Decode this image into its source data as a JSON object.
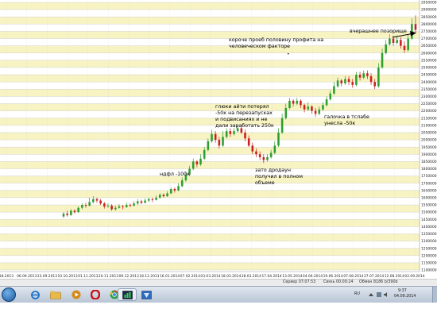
{
  "chart_data": {
    "type": "candlestick",
    "y_ticks": [
      "2950000",
      "2900000",
      "2850000",
      "2800000",
      "2750000",
      "2700000",
      "2650000",
      "2600000",
      "2550000",
      "2500000",
      "2450000",
      "2400000",
      "2350000",
      "2300000",
      "2250000",
      "2200000",
      "2150000",
      "2100000",
      "2050000",
      "2000000",
      "1950000",
      "1900000",
      "1850000",
      "1800000",
      "1750000",
      "1700000",
      "1650000",
      "1600000",
      "1550000",
      "1500000",
      "1450000",
      "1400000",
      "1350000",
      "1300000",
      "1250000",
      "1200000",
      "1150000",
      "1100000"
    ],
    "ylim": [
      1100000,
      2950000
    ],
    "x_ticks": [
      "18.2013",
      "06.09.2013",
      "23.09.2013",
      "10.10.2013",
      "01.11.2013",
      "20.11.2013",
      "09.12.2013",
      "18.12.2013",
      "16.01.2014",
      "07.02.2014",
      "03.03.2014",
      "18.03.2014",
      "28.03.2014",
      "17.04.2014",
      "13.05.2014",
      "04.06.2014",
      "19.06.2014",
      "07.08.2014",
      "27.07.2014",
      "12.08.2014",
      "02.09.2014"
    ],
    "candles": [
      [
        1470000,
        1490000,
        1460000,
        1500000
      ],
      [
        1490000,
        1480000,
        1470000,
        1510000
      ],
      [
        1480000,
        1510000,
        1475000,
        1520000
      ],
      [
        1510000,
        1500000,
        1490000,
        1520000
      ],
      [
        1500000,
        1530000,
        1495000,
        1540000
      ],
      [
        1530000,
        1550000,
        1520000,
        1560000
      ],
      [
        1550000,
        1545000,
        1530000,
        1565000
      ],
      [
        1545000,
        1570000,
        1540000,
        1600000
      ],
      [
        1570000,
        1590000,
        1560000,
        1610000
      ],
      [
        1590000,
        1580000,
        1565000,
        1600000
      ],
      [
        1580000,
        1560000,
        1550000,
        1590000
      ],
      [
        1560000,
        1540000,
        1525000,
        1570000
      ],
      [
        1540000,
        1545000,
        1530000,
        1560000
      ],
      [
        1545000,
        1520000,
        1510000,
        1555000
      ],
      [
        1520000,
        1530000,
        1510000,
        1545000
      ],
      [
        1530000,
        1540000,
        1525000,
        1555000
      ],
      [
        1540000,
        1535000,
        1520000,
        1550000
      ],
      [
        1535000,
        1550000,
        1530000,
        1565000
      ],
      [
        1550000,
        1545000,
        1535000,
        1560000
      ],
      [
        1545000,
        1560000,
        1540000,
        1575000
      ],
      [
        1560000,
        1575000,
        1550000,
        1590000
      ],
      [
        1575000,
        1565000,
        1555000,
        1585000
      ],
      [
        1565000,
        1580000,
        1560000,
        1595000
      ],
      [
        1580000,
        1590000,
        1570000,
        1600000
      ],
      [
        1590000,
        1585000,
        1570000,
        1600000
      ],
      [
        1585000,
        1600000,
        1580000,
        1615000
      ],
      [
        1600000,
        1620000,
        1595000,
        1630000
      ],
      [
        1620000,
        1610000,
        1600000,
        1630000
      ],
      [
        1610000,
        1630000,
        1605000,
        1645000
      ],
      [
        1630000,
        1660000,
        1625000,
        1670000
      ],
      [
        1660000,
        1650000,
        1635000,
        1670000
      ],
      [
        1650000,
        1680000,
        1645000,
        1700000
      ],
      [
        1680000,
        1720000,
        1670000,
        1740000
      ],
      [
        1720000,
        1760000,
        1710000,
        1780000
      ],
      [
        1760000,
        1800000,
        1750000,
        1820000
      ],
      [
        1800000,
        1850000,
        1790000,
        1870000
      ],
      [
        1850000,
        1830000,
        1810000,
        1860000
      ],
      [
        1830000,
        1870000,
        1820000,
        1900000
      ],
      [
        1870000,
        1930000,
        1860000,
        1950000
      ],
      [
        1930000,
        1990000,
        1920000,
        2010000
      ],
      [
        1990000,
        2040000,
        1980000,
        2070000
      ],
      [
        2040000,
        2000000,
        1980000,
        2060000
      ],
      [
        2000000,
        1960000,
        1940000,
        2020000
      ],
      [
        1960000,
        2020000,
        1950000,
        2060000
      ],
      [
        2020000,
        2060000,
        2010000,
        2080000
      ],
      [
        2060000,
        2040000,
        2020000,
        2080000
      ],
      [
        2040000,
        2060000,
        2030000,
        2080000
      ],
      [
        2060000,
        2080000,
        2050000,
        2100000
      ],
      [
        2080000,
        2050000,
        2040000,
        2100000
      ],
      [
        2050000,
        2010000,
        1990000,
        2070000
      ],
      [
        2010000,
        1960000,
        1950000,
        2030000
      ],
      [
        1960000,
        1920000,
        1900000,
        1980000
      ],
      [
        1920000,
        1900000,
        1880000,
        1940000
      ],
      [
        1900000,
        1880000,
        1860000,
        1920000
      ],
      [
        1880000,
        1860000,
        1840000,
        1900000
      ],
      [
        1860000,
        1880000,
        1850000,
        1900000
      ],
      [
        1880000,
        1910000,
        1870000,
        1930000
      ],
      [
        1910000,
        1960000,
        1900000,
        1990000
      ],
      [
        1960000,
        2050000,
        1950000,
        2080000
      ],
      [
        2050000,
        2150000,
        2040000,
        2180000
      ],
      [
        2150000,
        2220000,
        2140000,
        2250000
      ],
      [
        2220000,
        2270000,
        2210000,
        2290000
      ],
      [
        2270000,
        2250000,
        2230000,
        2280000
      ],
      [
        2250000,
        2270000,
        2240000,
        2290000
      ],
      [
        2270000,
        2240000,
        2220000,
        2280000
      ],
      [
        2240000,
        2210000,
        2190000,
        2250000
      ],
      [
        2210000,
        2230000,
        2200000,
        2260000
      ],
      [
        2230000,
        2200000,
        2180000,
        2240000
      ],
      [
        2200000,
        2180000,
        2160000,
        2220000
      ],
      [
        2180000,
        2210000,
        2170000,
        2230000
      ],
      [
        2210000,
        2240000,
        2200000,
        2260000
      ],
      [
        2240000,
        2280000,
        2230000,
        2300000
      ],
      [
        2280000,
        2320000,
        2270000,
        2340000
      ],
      [
        2320000,
        2370000,
        2310000,
        2400000
      ],
      [
        2370000,
        2410000,
        2360000,
        2430000
      ],
      [
        2410000,
        2390000,
        2370000,
        2420000
      ],
      [
        2390000,
        2420000,
        2380000,
        2440000
      ],
      [
        2420000,
        2400000,
        2380000,
        2440000
      ],
      [
        2400000,
        2380000,
        2360000,
        2420000
      ],
      [
        2380000,
        2450000,
        2370000,
        2470000
      ],
      [
        2450000,
        2430000,
        2410000,
        2470000
      ],
      [
        2430000,
        2460000,
        2420000,
        2480000
      ],
      [
        2460000,
        2440000,
        2420000,
        2480000
      ],
      [
        2440000,
        2400000,
        2380000,
        2460000
      ],
      [
        2400000,
        2370000,
        2350000,
        2420000
      ],
      [
        2370000,
        2500000,
        2360000,
        2530000
      ],
      [
        2500000,
        2600000,
        2490000,
        2630000
      ],
      [
        2600000,
        2660000,
        2590000,
        2690000
      ],
      [
        2660000,
        2700000,
        2650000,
        2730000
      ],
      [
        2700000,
        2670000,
        2650000,
        2720000
      ],
      [
        2670000,
        2690000,
        2660000,
        2720000
      ],
      [
        2690000,
        2650000,
        2630000,
        2710000
      ],
      [
        2650000,
        2620000,
        2600000,
        2680000
      ],
      [
        2620000,
        2700000,
        2610000,
        2730000
      ],
      [
        2700000,
        2800000,
        2690000,
        2840000
      ],
      [
        2800000,
        2760000,
        2740000,
        2860000
      ]
    ],
    "colors": {
      "up": "#2e9e2e",
      "down": "#cc1f1f",
      "grid": "#c9c9c9",
      "band": "#f7f3c2",
      "axis_bg": "#ffffff"
    }
  },
  "annotations": {
    "yesterday": "вчерашнее позорище",
    "human_factor": "короче проеб половину профита на\nчеловеческом факторе",
    "glitches": "глюки айти потерял\n-50к на перезапусках\nи подвисаниях и не\nдали заработать 250к",
    "ndfl": "ндфл -100к",
    "drawdown": "зато дродаун\nполучил в полном\nобъеме",
    "tick": "галочка в тслабе\nунесла -50к"
  },
  "status_bar": {
    "server": "Сервер 07:07:53",
    "connection": "Связь 00:00:24",
    "traffic": "Обмен 8186 b/390b"
  },
  "taskbar": {
    "tray_lang": "RU",
    "clock_time": "9:37",
    "clock_date": "04.09.2014"
  }
}
